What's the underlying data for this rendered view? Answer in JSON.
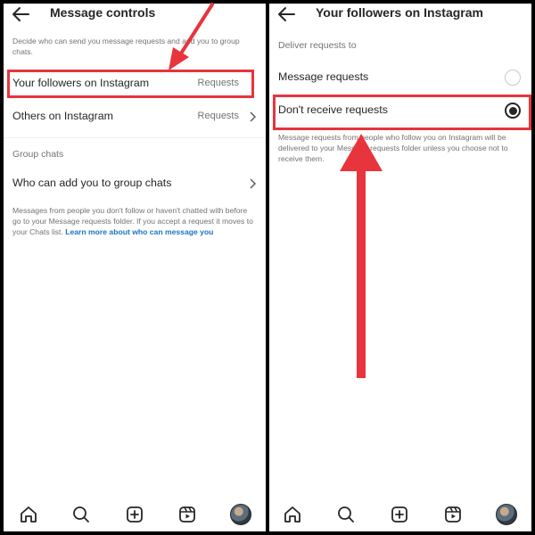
{
  "left": {
    "title": "Message controls",
    "description": "Decide who can send you message requests and add you to group chats.",
    "rows": [
      {
        "label": "Your followers on Instagram",
        "value": "Requests"
      },
      {
        "label": "Others on Instagram",
        "value": "Requests"
      }
    ],
    "group_section_title": "Group chats",
    "group_row_label": "Who can add you to group chats",
    "group_info_text": "Messages from people you don't follow or haven't chatted with before go to your Message requests folder. If you accept a request it moves to your Chats list.",
    "group_info_link": "Learn more about who can message you"
  },
  "right": {
    "title": "Your followers on Instagram",
    "section_title": "Deliver requests to",
    "options": [
      {
        "label": "Message requests",
        "selected": false
      },
      {
        "label": "Don't receive requests",
        "selected": true
      }
    ],
    "info_text": "Message requests from people who follow you on Instagram will be delivered to your Message requests folder unless you choose not to receive them."
  },
  "nav": {
    "items": [
      "home-icon",
      "search-icon",
      "create-icon",
      "reels-icon",
      "profile-avatar"
    ]
  },
  "colors": {
    "highlight": "#e8343c",
    "link": "#1a73c4",
    "text": "#262626",
    "muted": "#737373"
  }
}
